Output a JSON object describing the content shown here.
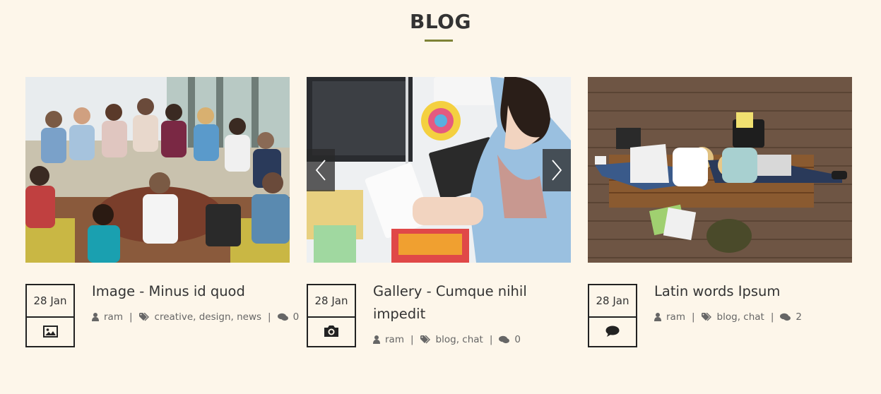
{
  "section": {
    "title": "BLOG"
  },
  "posts": [
    {
      "date": "28 Jan",
      "type_icon": "image-icon",
      "title": "Image - Minus id quod",
      "author": "ram",
      "tags": "creative, design, news",
      "comments": "0"
    },
    {
      "date": "28 Jan",
      "type_icon": "camera-icon",
      "title": "Gallery - Cumque nihil impedit",
      "author": "ram",
      "tags": "blog, chat",
      "comments": "0"
    },
    {
      "date": "28 Jan",
      "type_icon": "speech-bubble-icon",
      "title": "Latin words Ipsum",
      "author": "ram",
      "tags": "blog, chat",
      "comments": "2"
    }
  ],
  "colors": {
    "background": "#fdf6ea",
    "accent": "#7e8236",
    "text": "#333333",
    "meta": "#666666"
  }
}
